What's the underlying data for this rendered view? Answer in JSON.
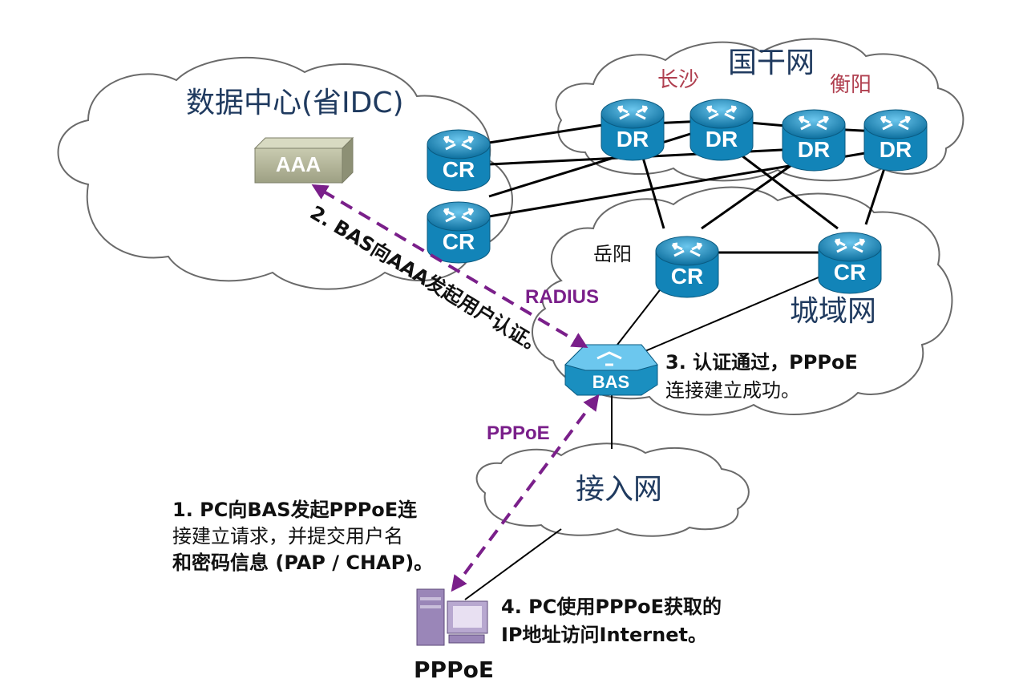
{
  "clouds": {
    "datacenter": "数据中心(省IDC)",
    "backbone": "国干网",
    "metro": "城域网",
    "access": "接入网"
  },
  "cities": {
    "changsha": "长沙",
    "hengyang": "衡阳",
    "yueyang": "岳阳"
  },
  "devices": {
    "aaa": "AAA",
    "cr": "CR",
    "dr": "DR",
    "bas": "BAS",
    "pc_label": "PPPoE"
  },
  "protocols": {
    "radius": "RADIUS",
    "pppoe": "PPPoE"
  },
  "steps": {
    "step1": [
      "1.  PC向BAS发起PPPoE连",
      "接建立请求，并提交用户名",
      "和密码信息 (PAP / CHAP)。"
    ],
    "step2": "2.  BAS向AAA发起用户认证。",
    "step3": [
      "3.  认证通过，PPPoE",
      "连接建立成功。"
    ],
    "step4": [
      "4.  PC使用PPPoE获取的",
      "IP地址访问Internet。"
    ]
  },
  "colors": {
    "router_fill": "#1a8fc0",
    "router_top": "#5bb8e0",
    "aaa_fill": "#b5b89a",
    "dashed_arrow": "#7a1f8a",
    "pc_fill": "#9a86b8"
  }
}
